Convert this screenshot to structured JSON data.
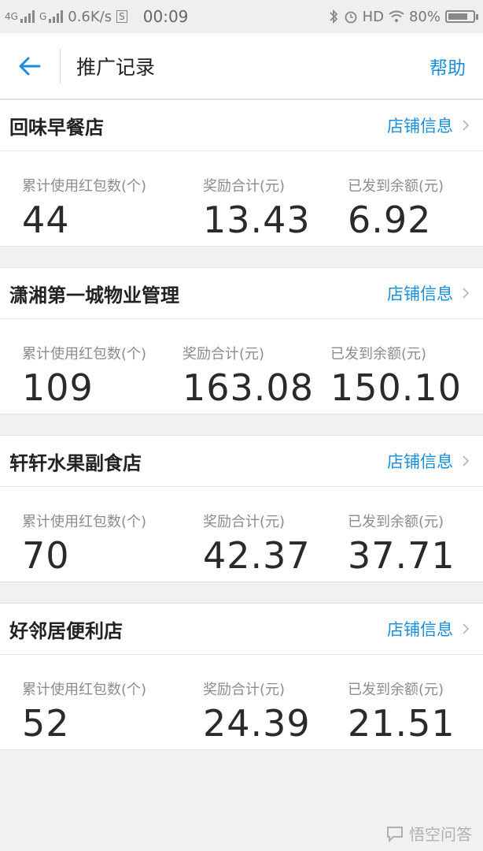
{
  "status_bar": {
    "network1": "4G",
    "network2": "G",
    "speed": "0.6K/s",
    "s_badge": "S",
    "time": "00:09",
    "hd": "HD",
    "battery": "80%"
  },
  "nav": {
    "title": "推广记录",
    "help_label": "帮助"
  },
  "columns": {
    "count_label": "累计使用红包数(个)",
    "reward_label": "奖励合计(元)",
    "paid_label": "已发到余额(元)"
  },
  "shop_link_label": "店铺信息",
  "shops": [
    {
      "name": "回味早餐店",
      "count": "44",
      "reward": "13.43",
      "paid": "6.92"
    },
    {
      "name": "潇湘第一城物业管理",
      "count": "109",
      "reward": "163.08",
      "paid": "150.10"
    },
    {
      "name": "轩轩水果副食店",
      "count": "70",
      "reward": "42.37",
      "paid": "37.71"
    },
    {
      "name": "好邻居便利店",
      "count": "52",
      "reward": "24.39",
      "paid": "21.51"
    }
  ],
  "watermark": "悟空问答",
  "colors": {
    "accent": "#1a8fd9",
    "background": "#f1f1f3"
  }
}
